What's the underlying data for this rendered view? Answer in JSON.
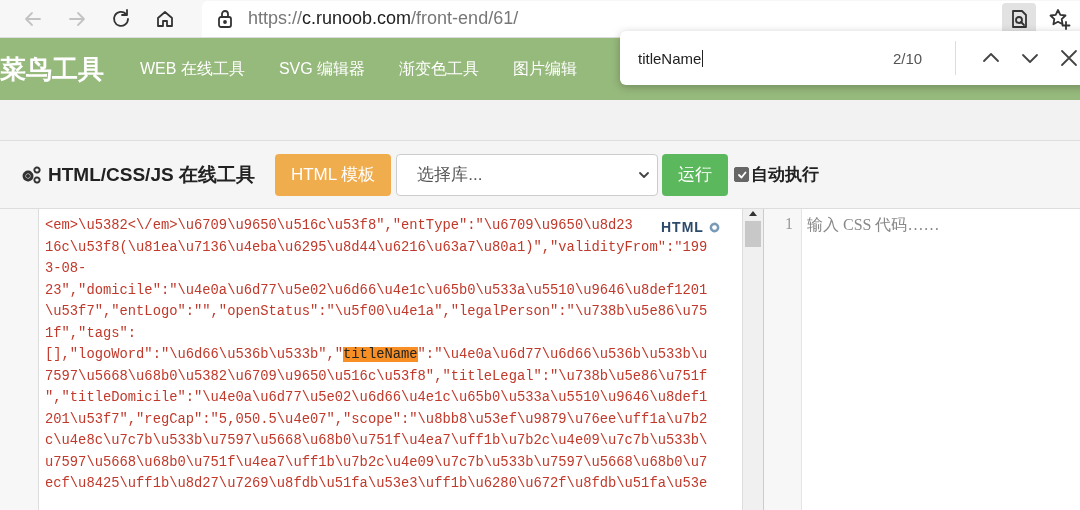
{
  "browser": {
    "nav_buttons": [
      {
        "kind": "back",
        "disabled": true
      },
      {
        "kind": "forward",
        "disabled": true
      },
      {
        "kind": "reload",
        "disabled": false
      },
      {
        "kind": "home",
        "disabled": false
      }
    ],
    "url": {
      "scheme": "https://",
      "host": "c.runoob.com",
      "path": "/front-end/61/"
    }
  },
  "site_nav": {
    "logo": "菜鸟工具",
    "items": [
      "WEB 在线工具",
      "SVG 编辑器",
      "渐变色工具",
      "图片编辑"
    ]
  },
  "find_bar": {
    "query": "titleName",
    "count": "2/10"
  },
  "toolbar": {
    "title": "HTML/CSS/JS 在线工具",
    "template_button": "HTML 模板",
    "library_select": {
      "value": "选择库..."
    },
    "run_button": "运行",
    "auto_run": {
      "label": "自动执行",
      "checked": true
    }
  },
  "html_editor": {
    "badge": "HTML",
    "lines": [
      {
        "text": "<em>\\u5382<\\/em>\\u6709\\u9650\\u516c\\u53f8\",\"entType\":\"\\u6709\\u9650\\u8d23"
      },
      {
        "text": "16c\\u53f8(\\u81ea\\u7136\\u4eba\\u6295\\u8d44\\u6216\\u63a7\\u80a1)\",\"validityFrom\":\"199"
      },
      {
        "text": "3-08-"
      },
      {
        "text": "23\",\"domicile\":\"\\u4e0a\\u6d77\\u5e02\\u6d66\\u4e1c\\u65b0\\u533a\\u5510\\u9646\\u8def1201"
      },
      {
        "text": "\\u53f7\",\"entLogo\":\"\",\"openStatus\":\"\\u5f00\\u4e1a\",\"legalPerson\":\"\\u738b\\u5e86\\u75"
      },
      {
        "text": "1f\",\"tags\":"
      },
      {
        "segments": [
          {
            "text": "[],\"logoWord\":\"\\u6d66\\u536b\\u533b\",\"",
            "highlighted": false
          },
          {
            "text": "titleName",
            "highlighted": true
          },
          {
            "text": "\":\"\\u4e0a\\u6d77\\u6d66\\u536b\\u533b\\u",
            "highlighted": false
          }
        ]
      },
      {
        "text": "7597\\u5668\\u68b0\\u5382\\u6709\\u9650\\u516c\\u53f8\",\"titleLegal\":\"\\u738b\\u5e86\\u751f"
      },
      {
        "text": "\",\"titleDomicile\":\"\\u4e0a\\u6d77\\u5e02\\u6d66\\u4e1c\\u65b0\\u533a\\u5510\\u9646\\u8def1"
      },
      {
        "text": "201\\u53f7\",\"regCap\":\"5,050.5\\u4e07\",\"scope\":\"\\u8bb8\\u53ef\\u9879\\u76ee\\uff1a\\u7b2"
      },
      {
        "text": "c\\u4e8c\\u7c7b\\u533b\\u7597\\u5668\\u68b0\\u751f\\u4ea7\\uff1b\\u7b2c\\u4e09\\u7c7b\\u533b\\"
      },
      {
        "text": "u7597\\u5668\\u68b0\\u751f\\u4ea7\\uff1b\\u7b2c\\u4e09\\u7c7b\\u533b\\u7597\\u5668\\u68b0\\u7"
      },
      {
        "text": "ecf\\u8425\\uff1b\\u8d27\\u7269\\u8fdb\\u51fa\\u53e3\\uff1b\\u6280\\u672f\\u8fdb\\u51fa\\u53e"
      }
    ]
  },
  "css_editor": {
    "line_numbers": [
      "1"
    ],
    "placeholder": "输入 CSS 代码……"
  }
}
